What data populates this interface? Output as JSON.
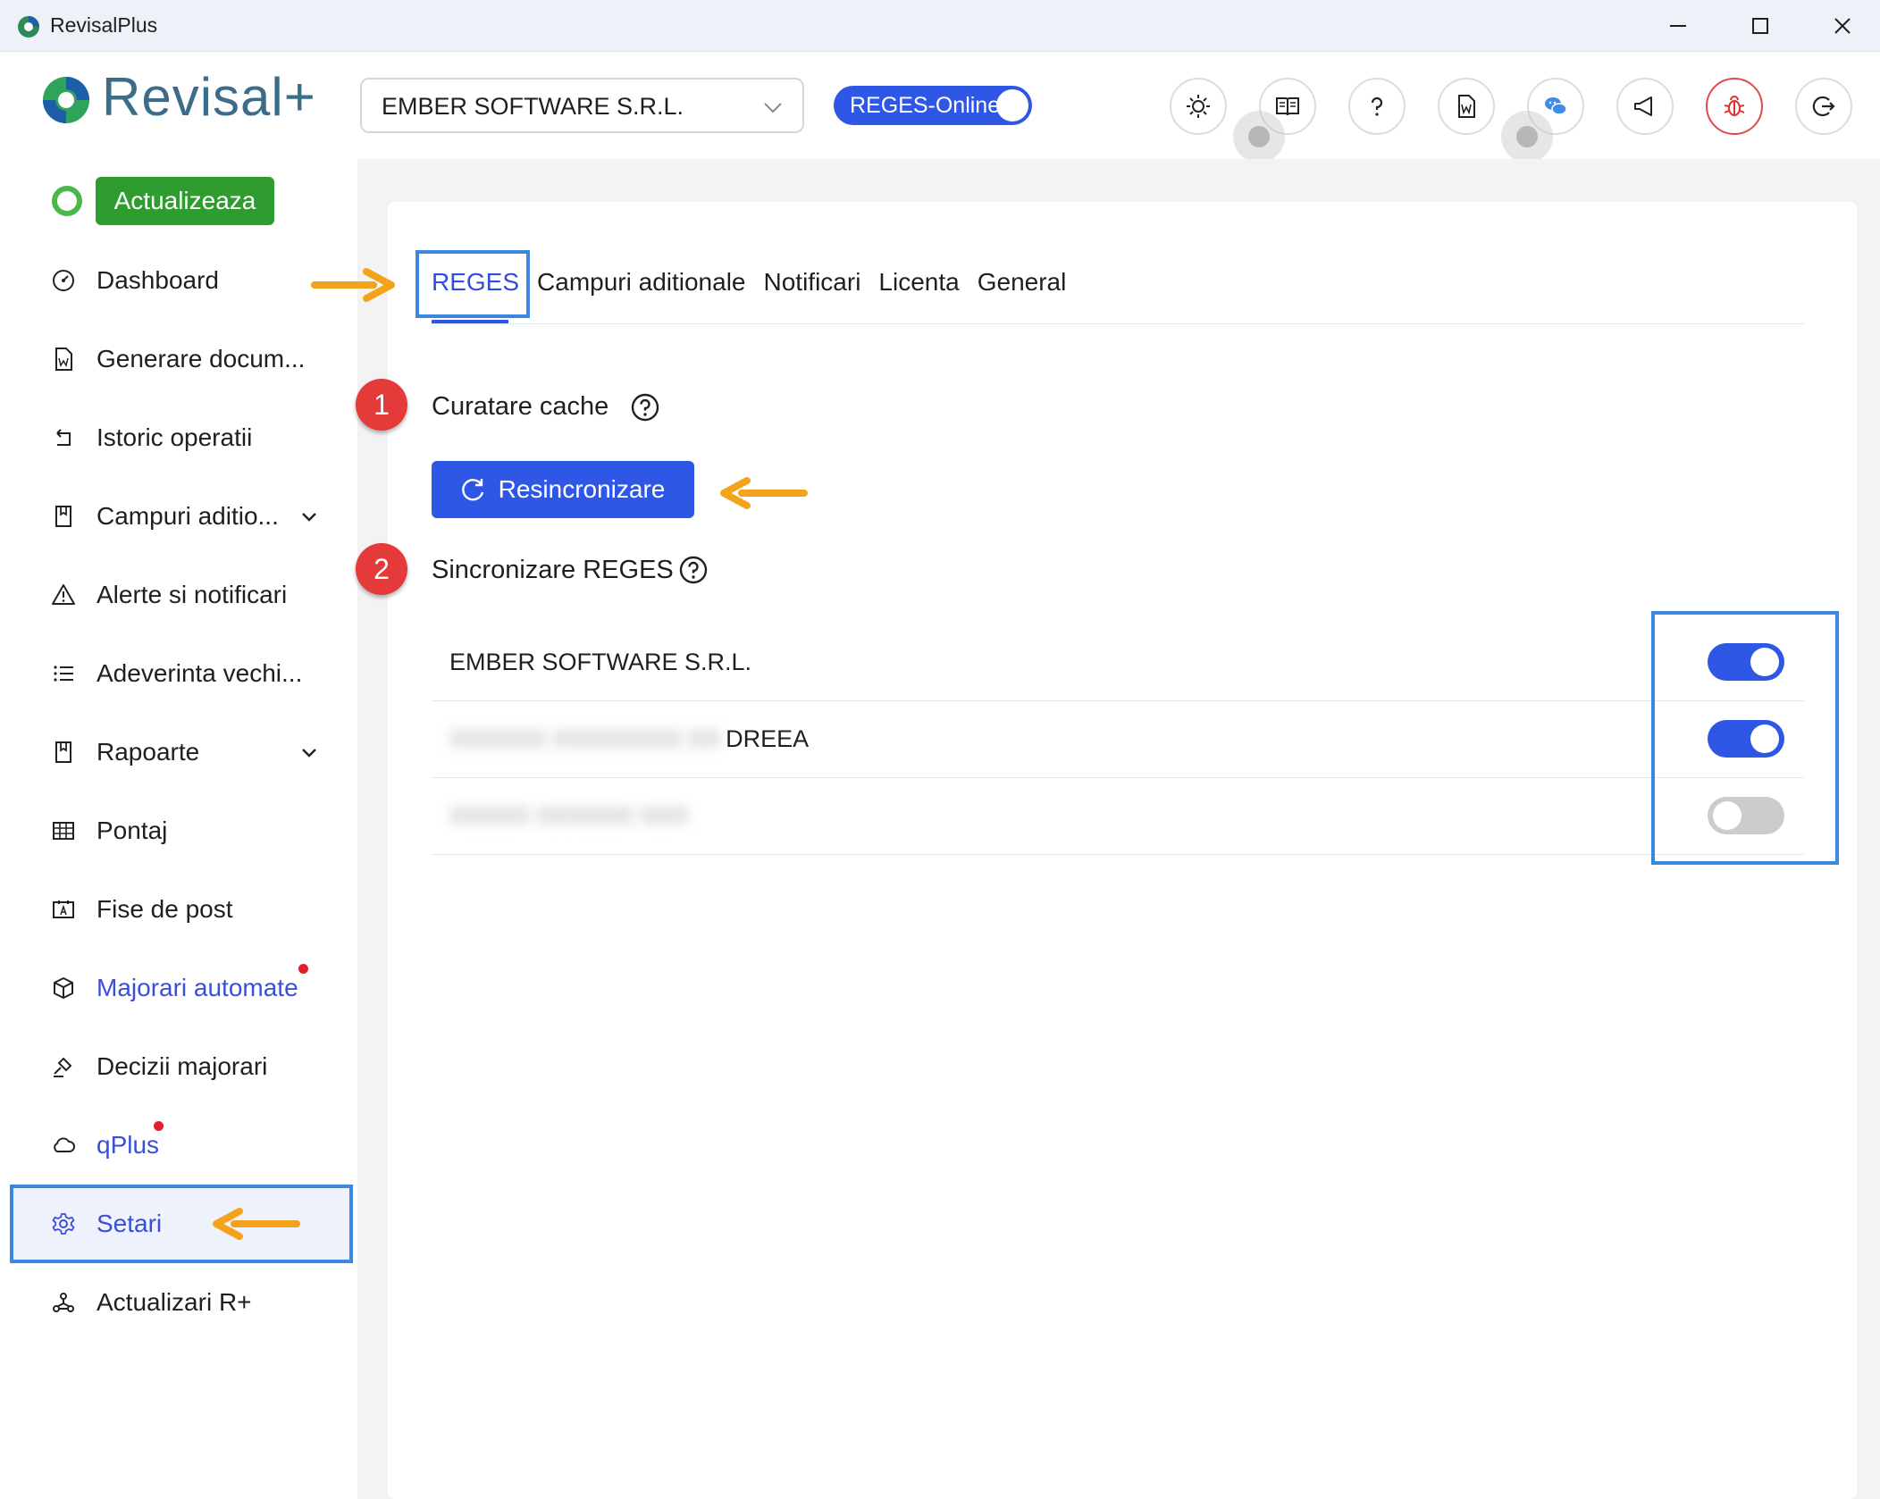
{
  "window": {
    "title": "RevisalPlus"
  },
  "header": {
    "logo_text": "Revisal+",
    "company_select": {
      "value": "EMBER SOFTWARE S.R.L."
    },
    "reges_toggle": {
      "label": "REGES-Online",
      "on": true
    },
    "icon_buttons": [
      "sun-icon",
      "book-icon",
      "help-icon",
      "word-doc-icon",
      "chat-icon",
      "megaphone-icon",
      "bug-icon",
      "logout-icon"
    ]
  },
  "sidebar": {
    "update_button": "Actualizeaza",
    "items": [
      {
        "label": "Dashboard",
        "icon": "dashboard-icon"
      },
      {
        "label": "Generare docum...",
        "icon": "word-file-icon"
      },
      {
        "label": "Istoric operatii",
        "icon": "history-icon"
      },
      {
        "label": "Campuri aditio...",
        "icon": "bookmark-icon",
        "expandable": true
      },
      {
        "label": "Alerte si notificari",
        "icon": "warning-icon"
      },
      {
        "label": "Adeverinta vechi...",
        "icon": "list-icon"
      },
      {
        "label": "Rapoarte",
        "icon": "bookmark-icon",
        "expandable": true
      },
      {
        "label": "Pontaj",
        "icon": "grid-icon"
      },
      {
        "label": "Fise de post",
        "icon": "id-card-icon"
      },
      {
        "label": "Majorari automate",
        "icon": "cube-icon",
        "new": true
      },
      {
        "label": "Decizii majorari",
        "icon": "gavel-icon"
      },
      {
        "label": "qPlus",
        "icon": "cloud-icon",
        "new": true
      },
      {
        "label": "Setari",
        "icon": "settings-icon",
        "active": true
      },
      {
        "label": "Actualizari R+",
        "icon": "network-icon"
      }
    ]
  },
  "main": {
    "tabs": [
      "REGES",
      "Campuri aditionale",
      "Notificari",
      "Licenta",
      "General"
    ],
    "active_tab": "REGES",
    "sections": [
      {
        "badge": "1",
        "title": "Curatare cache",
        "button": "Resincronizare"
      },
      {
        "badge": "2",
        "title": "Sincronizare REGES"
      }
    ],
    "companies": [
      {
        "name": "EMBER SOFTWARE S.R.L.",
        "enabled": true
      },
      {
        "name_visible": "DREEA",
        "enabled": true
      },
      {
        "enabled": false
      }
    ]
  },
  "colors": {
    "accent": "#2f57e6",
    "update_green": "#2e9c2e",
    "annotation_blue": "#3b86de",
    "annotation_arrow": "#f3a21b",
    "badge_red": "#e53a3a"
  }
}
